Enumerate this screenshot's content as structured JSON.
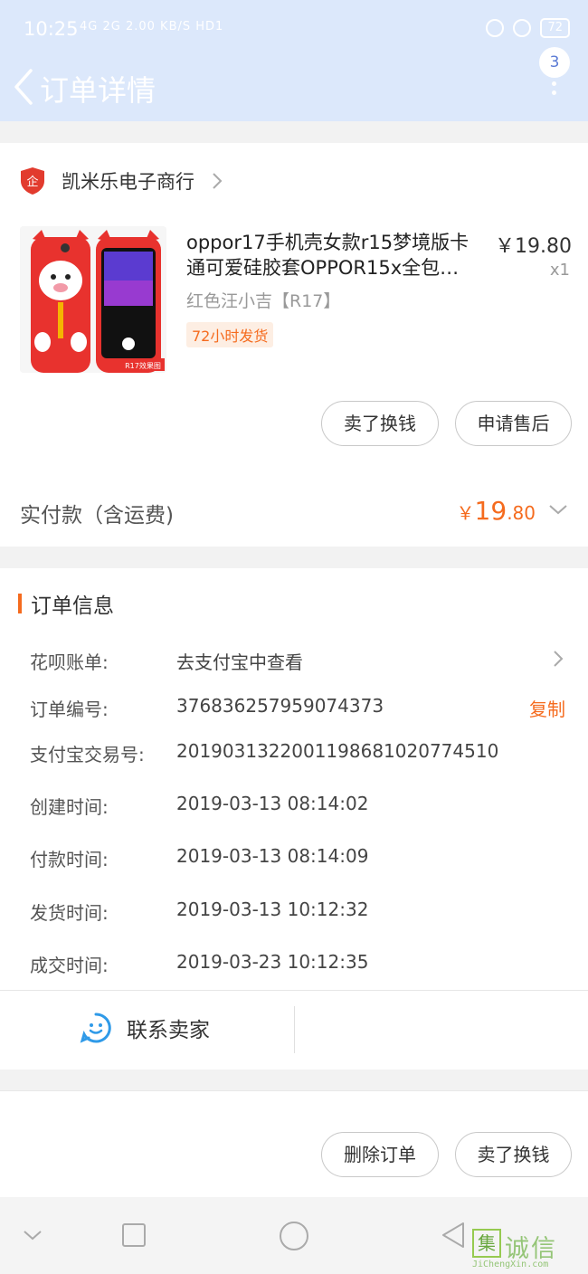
{
  "status_bar": {
    "time": "10:25",
    "signal_text": "4G 2G",
    "network_speed": "2.00 KB/S",
    "hd_label": "HD1",
    "battery": "72"
  },
  "nav": {
    "title": "订单详情",
    "badge_count": "3"
  },
  "shop": {
    "name": "凯米乐电子商行",
    "icon_text": "企"
  },
  "product": {
    "title": "oppor17手机壳女款r15梦境版卡通可爱硅胶套OPPOR15x全包…",
    "price": "￥19.80",
    "quantity": "x1",
    "variant": "红色汪小吉【R17】",
    "shipping_tag": "72小时发货",
    "thumb_label": "R17效果图"
  },
  "actions": {
    "sell_label": "卖了换钱",
    "after_sale_label": "申请售后"
  },
  "payment": {
    "label": "实付款（含运费)",
    "currency": "￥",
    "amount_int": "19",
    "amount_dec": ".80"
  },
  "order_info": {
    "title": "订单信息",
    "rows": [
      {
        "label": "花呗账单:",
        "value": "去支付宝中查看"
      },
      {
        "label": "订单编号:",
        "value": "376836257959074373",
        "action": "复制"
      },
      {
        "label": "支付宝交易号:",
        "value": "2019031322001198681020774510"
      },
      {
        "label": "创建时间:",
        "value": "2019-03-13 08:14:02"
      },
      {
        "label": "付款时间:",
        "value": "2019-03-13 08:14:09"
      },
      {
        "label": "发货时间:",
        "value": "2019-03-13 10:12:32"
      },
      {
        "label": "成交时间:",
        "value": "2019-03-23 10:12:35"
      }
    ],
    "contact_label": "联系卖家"
  },
  "bottom": {
    "delete_label": "删除订单",
    "sell_label": "卖了换钱"
  },
  "watermark": {
    "box_char": "集",
    "text": "诚信",
    "url": "JiChengXin.com"
  },
  "colors": {
    "accent": "#f56b1e",
    "header_bg": "#dce8fb",
    "contact_blue": "#2f9ae8"
  }
}
